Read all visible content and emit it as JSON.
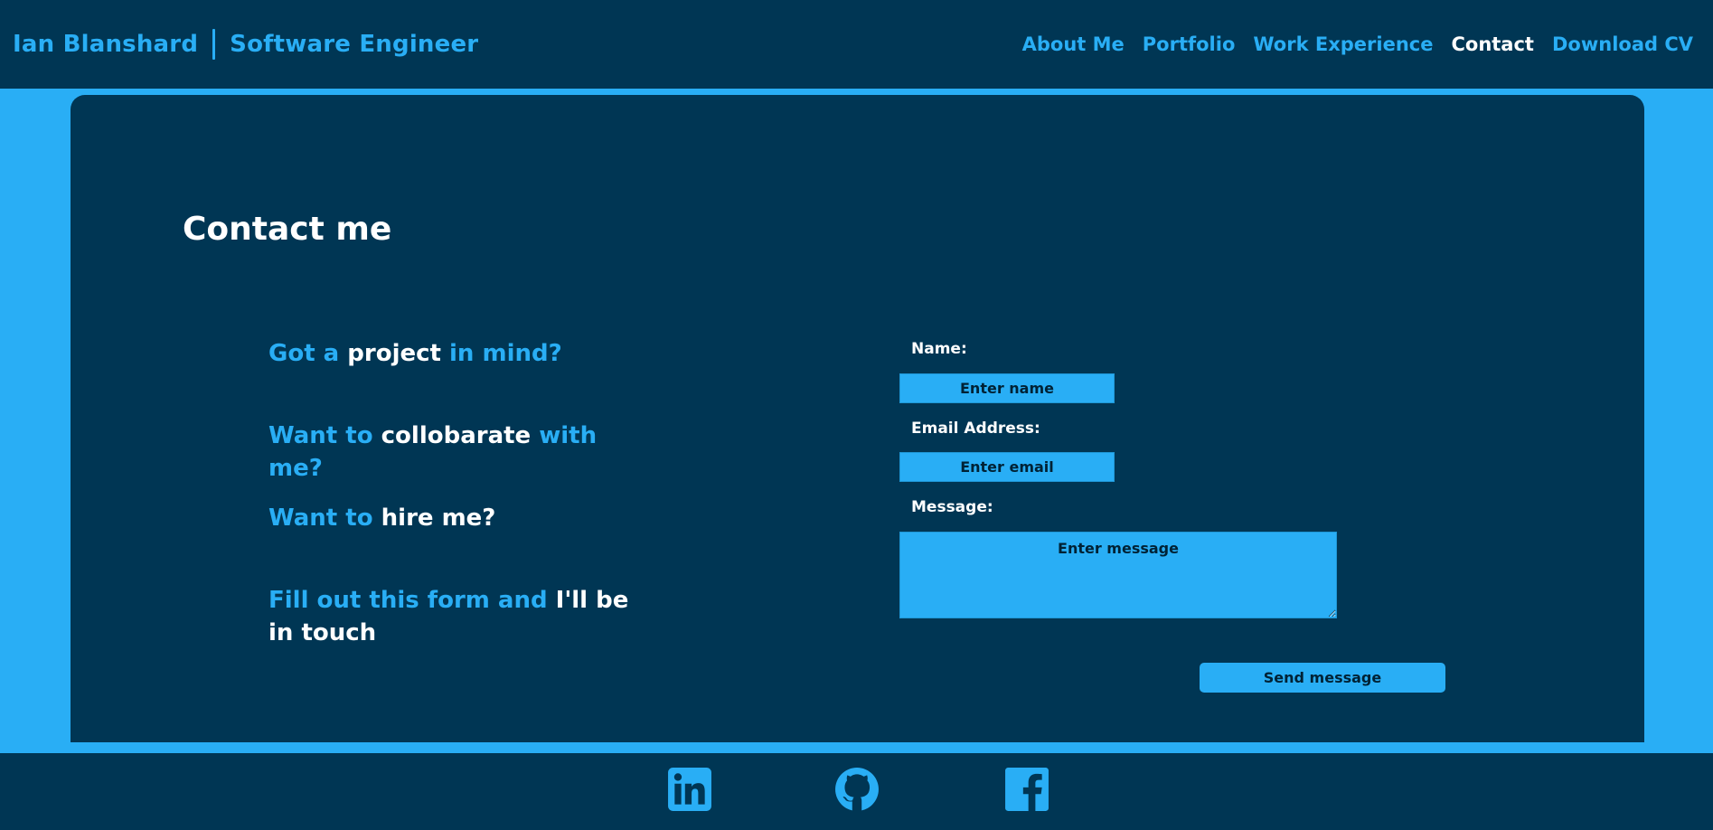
{
  "header": {
    "name": "Ian Blanshard",
    "role": "Software Engineer",
    "nav": [
      {
        "label": "About Me",
        "active": false
      },
      {
        "label": "Portfolio",
        "active": false
      },
      {
        "label": "Work Experience",
        "active": false
      },
      {
        "label": "Contact",
        "active": true
      },
      {
        "label": "Download CV",
        "active": false
      }
    ]
  },
  "main": {
    "title": "Contact me",
    "pitch": [
      {
        "a": "Got a ",
        "b": "project",
        "c": " in mind?"
      },
      {
        "a": "Want to ",
        "b": "collobarate",
        "c": " with me?"
      },
      {
        "a": "Want to ",
        "b": "hire me?",
        "c": ""
      },
      {
        "a": "Fill out this form and ",
        "b": "I'll be in touch",
        "c": ""
      }
    ]
  },
  "form": {
    "name_label": "Name:",
    "name_placeholder": "Enter name",
    "email_label": "Email Address:",
    "email_placeholder": "Enter email",
    "message_label": "Message:",
    "message_placeholder": "Enter message",
    "submit_label": "Send message"
  },
  "footer": {
    "icons": [
      "linkedin-icon",
      "github-icon",
      "facebook-icon"
    ]
  },
  "colors": {
    "navy": "#003654",
    "accent": "#29aef5",
    "text": "#ffffff"
  }
}
